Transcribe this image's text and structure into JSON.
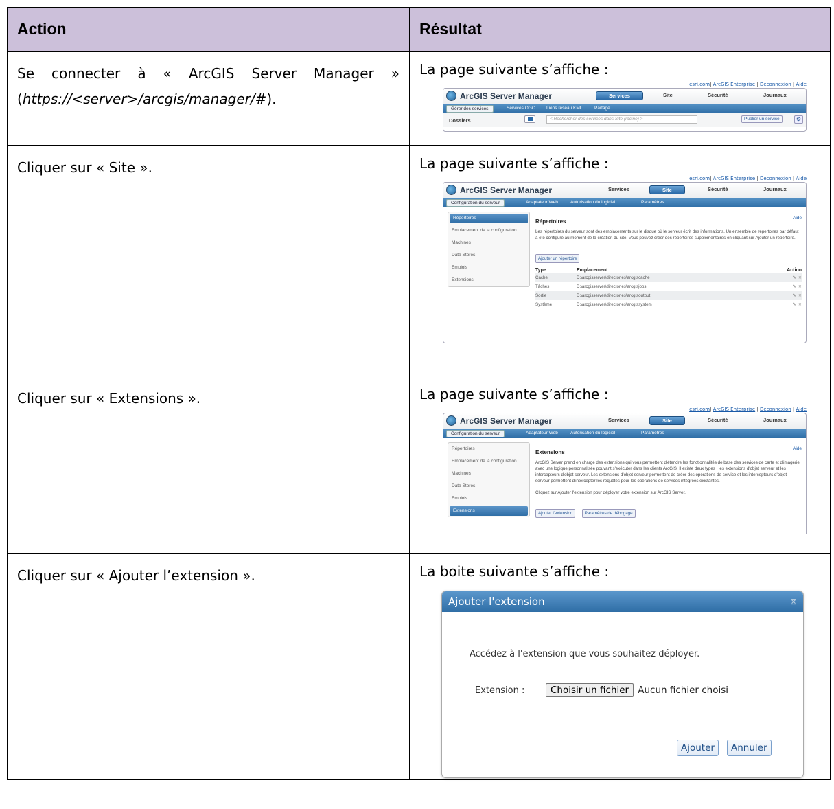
{
  "table": {
    "headers": {
      "action": "Action",
      "result": "Résultat"
    },
    "rows": [
      {
        "action_pre": "Se connecter à « ArcGIS Server Manager »",
        "action_url": "https://<server>/arcgis/manager/#",
        "action_post": ").",
        "action_open": "(",
        "result": "La page suivante s’affiche :"
      },
      {
        "action": "Cliquer sur « Site ».",
        "result": "La page suivante s’affiche :"
      },
      {
        "action": "Cliquer sur « Extensions ».",
        "result": "La page suivante s’affiche :"
      },
      {
        "action": "Cliquer sur « Ajouter l’extension ».",
        "result": "La boite suivante s’affiche :"
      }
    ]
  },
  "arcgis": {
    "toplinks": {
      "esri": "esri.com",
      "enterprise": "ArcGIS Enterprise",
      "logout": "Déconnexion",
      "help": "Aide"
    },
    "app_title": "ArcGIS Server Manager",
    "topnav": {
      "services": "Services",
      "site": "Site",
      "security": "Sécurité",
      "logs": "Journaux"
    },
    "services_subnav": [
      "Gérer des services",
      "Services OGC",
      "Liens réseau KML",
      "Partage"
    ],
    "site_subnav": [
      "Configuration du serveur",
      "Adaptateur Web",
      "Autorisation du logiciel",
      "Paramètres"
    ],
    "folders_label": "Dossiers",
    "search_placeholder": "< Rechercher des services dans Site (racine) >",
    "publish_button": "Publier un service",
    "sidebar": [
      "Répertoires",
      "Emplacement de la configuration",
      "Machines",
      "Data Stores",
      "Emplois",
      "Extensions"
    ],
    "help_link": "Aide",
    "directories": {
      "title": "Répertoires",
      "description": "Les répertoires du serveur sont des emplacements sur le disque où le serveur écrit des informations. Un ensemble de répertoires par défaut a été configuré au moment de la création du site. Vous pouvez créer des répertoires supplémentaires en cliquant sur Ajouter un répertoire.",
      "add_button": "Ajouter un répertoire",
      "col_type": "Type",
      "col_location": "Emplacement :",
      "col_action": "Action",
      "rows": [
        {
          "type": "Cache",
          "location": "D:\\arcgisserver\\directories\\arcgiscache"
        },
        {
          "type": "Tâches",
          "location": "D:\\arcgisserver\\directories\\arcgisjobs"
        },
        {
          "type": "Sortie",
          "location": "D:\\arcgisserver\\directories\\arcgisoutput"
        },
        {
          "type": "Système",
          "location": "D:\\arcgisserver\\directories\\arcgissystem"
        }
      ]
    },
    "extensions": {
      "title": "Extensions",
      "description": "ArcGIS Server prend en charge des extensions qui vous permettent d'étendre les fonctionnalités de base des services de carte et d'imagerie avec une logique personnalisée pouvant s'exécuter dans les clients ArcGIS. Il existe deux types : les extensions d'objet serveur et les intercepteurs d'objet serveur. Les extensions d'objet serveur permettent de créer des opérations de service et les intercepteurs d'objet serveur permettent d'intercepter les requêtes pour les opérations de services intégrées existantes.",
      "instruction": "Cliquez sur Ajouter l'extension pour déployer votre extension sur ArcGIS Server.",
      "add_button": "Ajouter l'extension",
      "debug_button": "Paramètres de débogage"
    },
    "dialog": {
      "title": "Ajouter l'extension",
      "prompt": "Accédez à l'extension que vous souhaitez déployer.",
      "field_label": "Extension :",
      "file_button": "Choisir un fichier",
      "file_status": "Aucun fichier choisi",
      "ok_button": "Ajouter",
      "cancel_button": "Annuler"
    }
  }
}
